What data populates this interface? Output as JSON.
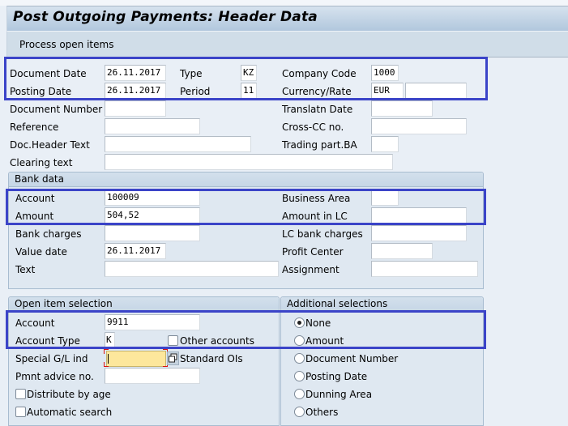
{
  "window": {
    "title": "Post Outgoing Payments: Header Data"
  },
  "toolbar": {
    "process_open_items_label": "Process open items"
  },
  "header": {
    "document_date": {
      "label": "Document Date",
      "value": "26.11.2017"
    },
    "type": {
      "label": "Type",
      "value": "KZ"
    },
    "company_code": {
      "label": "Company Code",
      "value": "1000"
    },
    "posting_date": {
      "label": "Posting Date",
      "value": "26.11.2017"
    },
    "period": {
      "label": "Period",
      "value": "11"
    },
    "currency_rate": {
      "label": "Currency/Rate",
      "currency": "EUR",
      "rate": ""
    },
    "document_number": {
      "label": "Document Number",
      "value": ""
    },
    "translatn_date": {
      "label": "Translatn Date",
      "value": ""
    },
    "reference": {
      "label": "Reference",
      "value": ""
    },
    "cross_cc_no": {
      "label": "Cross-CC no.",
      "value": ""
    },
    "doc_header_text": {
      "label": "Doc.Header Text",
      "value": ""
    },
    "trading_part_ba": {
      "label": "Trading part.BA",
      "value": ""
    },
    "clearing_text": {
      "label": "Clearing text",
      "value": ""
    }
  },
  "bank_data": {
    "title": "Bank data",
    "account": {
      "label": "Account",
      "value": "100009"
    },
    "business_area": {
      "label": "Business Area",
      "value": ""
    },
    "amount": {
      "label": "Amount",
      "value": "504,52"
    },
    "amount_in_lc": {
      "label": "Amount in LC",
      "value": ""
    },
    "bank_charges": {
      "label": "Bank charges",
      "value": ""
    },
    "lc_bank_charges": {
      "label": "LC bank charges",
      "value": ""
    },
    "value_date": {
      "label": "Value date",
      "value": "26.11.2017"
    },
    "profit_center": {
      "label": "Profit Center",
      "value": ""
    },
    "text": {
      "label": "Text",
      "value": ""
    },
    "assignment": {
      "label": "Assignment",
      "value": ""
    }
  },
  "open_item_selection": {
    "title": "Open item selection",
    "account": {
      "label": "Account",
      "value": "9911"
    },
    "account_type": {
      "label": "Account Type",
      "value": "K"
    },
    "other_accounts": {
      "label": "Other accounts",
      "checked": false
    },
    "special_gl_ind": {
      "label": "Special G/L ind",
      "value": ""
    },
    "standard_ois": {
      "label": "Standard OIs"
    },
    "pmnt_advice_no": {
      "label": "Pmnt advice no.",
      "value": ""
    },
    "distribute_by_age": {
      "label": "Distribute by age",
      "checked": false
    },
    "automatic_search": {
      "label": "Automatic search",
      "checked": false
    }
  },
  "additional_selections": {
    "title": "Additional selections",
    "selected": "None",
    "options": [
      "None",
      "Amount",
      "Document Number",
      "Posting Date",
      "Dunning Area",
      "Others"
    ]
  },
  "colors": {
    "highlight_box": "#3b44c8",
    "background": "#e9eff6",
    "focused_field": "#fde79c",
    "required_marker": "#dd1111"
  }
}
